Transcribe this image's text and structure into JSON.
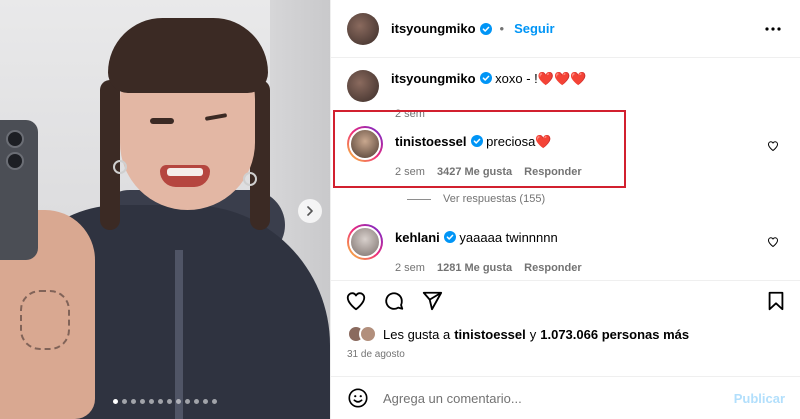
{
  "post_header": {
    "username": "itsyoungmiko",
    "follow_label": "Seguir",
    "bullet": "•"
  },
  "caption": {
    "username": "itsyoungmiko",
    "text": "xoxo - !❤️❤️❤️",
    "time": "2 sem"
  },
  "comments": [
    {
      "username": "tinistoessel",
      "text": "preciosa❤️",
      "time": "2 sem",
      "likes": "3427 Me gusta",
      "reply_label": "Responder",
      "view_replies": "Ver respuestas (155)"
    },
    {
      "username": "kehlani",
      "text": "yaaaaa twinnnnn",
      "time": "2 sem",
      "likes": "1281 Me gusta",
      "reply_label": "Responder"
    }
  ],
  "likes_summary": {
    "prefix": "Les gusta a",
    "user": "tinistoessel",
    "connector": "y",
    "others": "1.073.066 personas más"
  },
  "date": "31 de agosto",
  "composer": {
    "placeholder": "Agrega un comentario...",
    "publish_label": "Publicar"
  },
  "carousel": {
    "total_slides": 12,
    "active_slide": 1
  },
  "colors": {
    "accent": "#0095f6",
    "highlight_box": "#d2202f",
    "publish_disabled": "#b2dffc",
    "heart": "#e0245e"
  }
}
